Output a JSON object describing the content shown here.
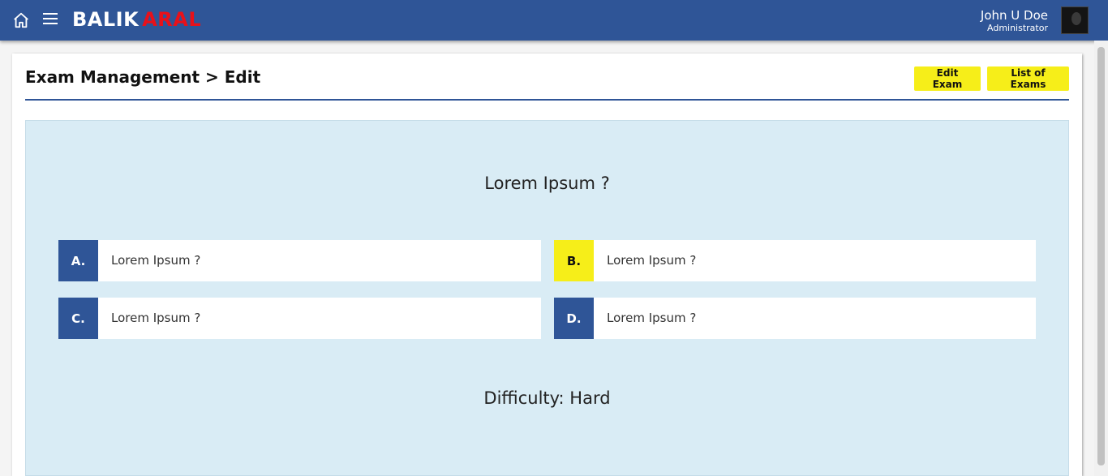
{
  "header": {
    "brand_main": "BALIK",
    "brand_accent": "ARAL",
    "user_name": "John U Doe",
    "user_role": "Administrator",
    "icons": {
      "home": "home-icon",
      "menu": "hamburger-menu-icon"
    },
    "colors": {
      "bar": "#2f5597",
      "accent": "#e8111a"
    }
  },
  "page": {
    "title": "Exam Management > Edit",
    "buttons": {
      "edit_exam": "Edit Exam",
      "list_exams": "List of Exams"
    }
  },
  "question": {
    "text": "Lorem Ipsum ?",
    "options": [
      {
        "letter": "A.",
        "text": "Lorem Ipsum ?",
        "selected": false
      },
      {
        "letter": "B.",
        "text": "Lorem Ipsum ?",
        "selected": true
      },
      {
        "letter": "C.",
        "text": "Lorem Ipsum ?",
        "selected": false
      },
      {
        "letter": "D.",
        "text": "Lorem Ipsum ?",
        "selected": false
      }
    ],
    "difficulty_label": "Difficulty: Hard"
  }
}
